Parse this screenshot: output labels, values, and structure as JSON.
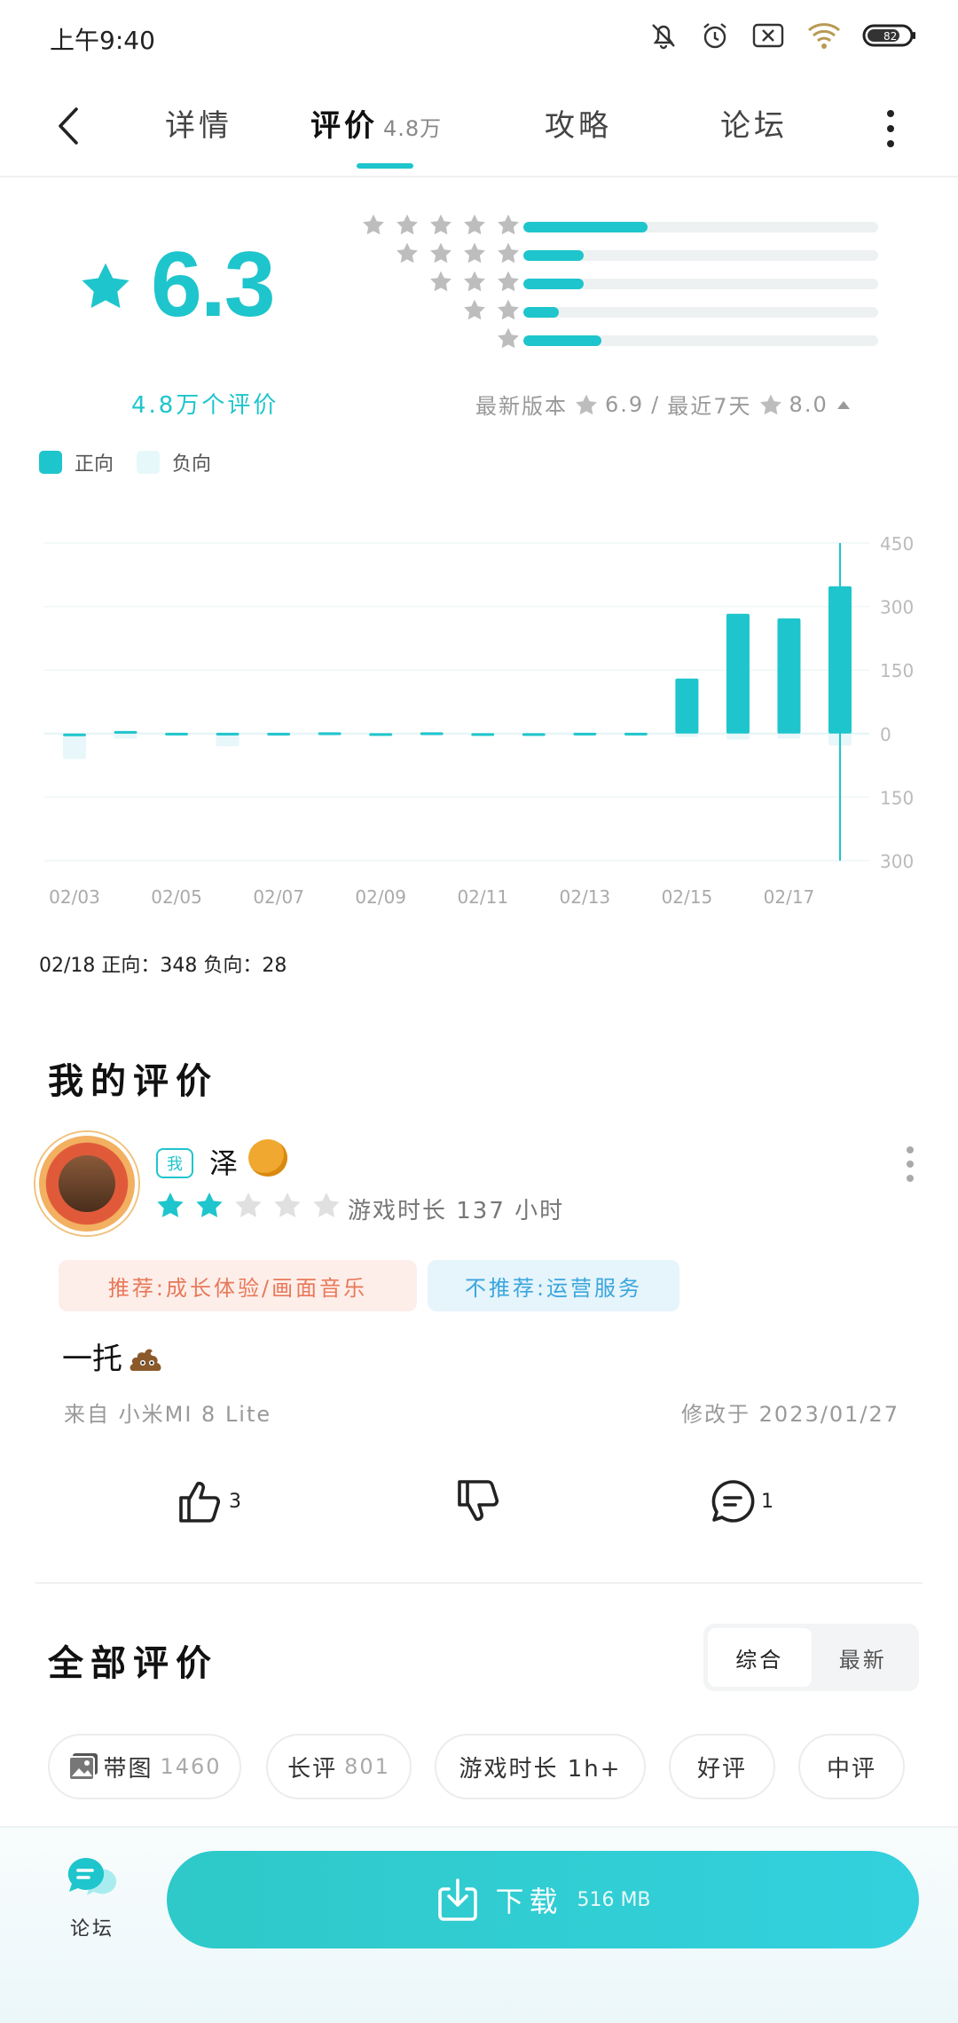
{
  "status": {
    "time": "上午9:40",
    "battery": "82"
  },
  "tabs": [
    {
      "label": "详情"
    },
    {
      "label": "评价",
      "count": "4.8万"
    },
    {
      "label": "攻略"
    },
    {
      "label": "论坛"
    }
  ],
  "rating": {
    "score": "6.3",
    "count_label": "4.8万个评价",
    "distribution": [
      {
        "stars": 5,
        "fraction": 0.35
      },
      {
        "stars": 4,
        "fraction": 0.17
      },
      {
        "stars": 3,
        "fraction": 0.17
      },
      {
        "stars": 2,
        "fraction": 0.1
      },
      {
        "stars": 1,
        "fraction": 0.22
      }
    ],
    "latest_version_label": "最新版本",
    "latest_version_score": "6.9",
    "recent_label": "最近7天",
    "recent_score": "8.0"
  },
  "legend": {
    "positive": "正向",
    "negative": "负向"
  },
  "chart_data": {
    "type": "bar",
    "categories": [
      "02/03",
      "02/04",
      "02/05",
      "02/06",
      "02/07",
      "02/08",
      "02/09",
      "02/10",
      "02/11",
      "02/12",
      "02/13",
      "02/14",
      "02/15",
      "02/16",
      "02/17",
      "02/18"
    ],
    "x_tick_labels": [
      "02/03",
      "02/05",
      "02/07",
      "02/09",
      "02/11",
      "02/13",
      "02/15",
      "02/17"
    ],
    "series": [
      {
        "name": "正向",
        "values": [
          0,
          6,
          2,
          2,
          2,
          3,
          1,
          3,
          1,
          1,
          2,
          2,
          130,
          283,
          272,
          348
        ]
      },
      {
        "name": "负向",
        "values": [
          60,
          12,
          4,
          30,
          6,
          6,
          2,
          6,
          3,
          3,
          4,
          4,
          8,
          14,
          12,
          28
        ]
      }
    ],
    "y_tick_labels": [
      "450",
      "300",
      "150",
      "0",
      "150",
      "300"
    ],
    "ylim": [
      -300,
      450
    ],
    "colors": {
      "positive": "#1ec5cc",
      "negative": "#e8f7f9"
    },
    "grid": true,
    "selected": {
      "category": "02/18",
      "caption": "02/18 正向：348  负向：28"
    }
  },
  "my_review": {
    "section_title": "我的评价",
    "me_tag": "我",
    "username": "泽",
    "user_stars": 2,
    "playtime": "游戏时长 137 小时",
    "tag_pro": "推荐:成长体验/画面音乐",
    "tag_con": "不推荐:运营服务",
    "text": "一托",
    "device": "来自 小米MI 8 Lite",
    "modified": "修改于 2023/01/27",
    "likes": "3",
    "comments": "1"
  },
  "all_reviews": {
    "section_title": "全部评价",
    "sort_options": [
      "综合",
      "最新"
    ],
    "filters": [
      {
        "label": "带图",
        "count": "1460"
      },
      {
        "label": "长评",
        "count": "801"
      },
      {
        "label": "游戏时长 1h+",
        "count": ""
      },
      {
        "label": "好评",
        "count": ""
      },
      {
        "label": "中评",
        "count": ""
      }
    ]
  },
  "bottom": {
    "forum_label": "论坛",
    "download_label": "下载",
    "download_size": "516 MB"
  },
  "colors": {
    "accent": "#1ec5cc",
    "star_gray": "#bdbdbd",
    "star_light": "#e0e0e0"
  }
}
